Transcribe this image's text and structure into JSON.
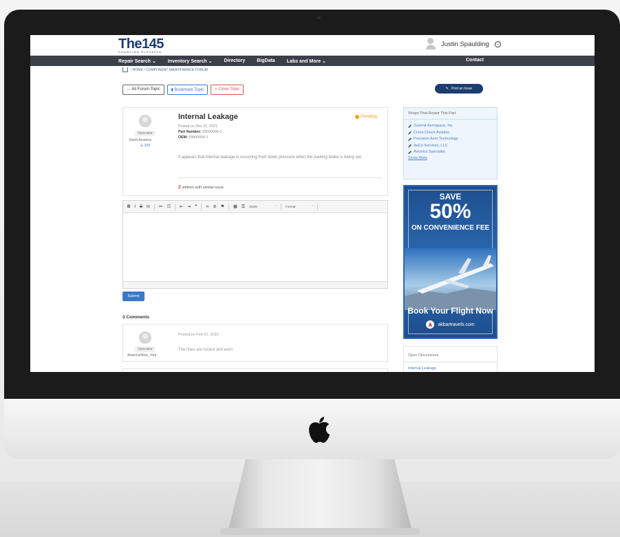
{
  "brand": {
    "logo_text": "The",
    "logo_num": "145",
    "tagline": "SOURCING ELEVATED"
  },
  "user": {
    "name": "Justin Spaulding"
  },
  "nav": {
    "items": [
      "Repair Search ⌄",
      "Inventory Search ⌄",
      "Directory",
      "BigData",
      "Labs and More ⌄"
    ],
    "contact": "Contact"
  },
  "breadcrumb": "/ HOME / COMPONENT MAINTENANCE FORUM",
  "buttons": {
    "all_forum": "← All Forum Topic",
    "bookmark": "Bookmark Topic",
    "close": "× Close Topic",
    "post_issue": "Post an Issue"
  },
  "issue": {
    "author_role": "Operator",
    "author_region": "North America",
    "author_points": "◎ 209",
    "title": "Internal Leakage",
    "status": "Pending",
    "posted": "Posted on Dec 21, 2021",
    "part_number_label": "Part Number:",
    "part_number": "59500000-1",
    "oem_label": "OEM:",
    "oem": "59500000-1",
    "body": "It appears that internal leakage is occurring from down pressure when the parking brake is being set.",
    "similar_count": "2",
    "similar_text": "airlines with similar issue"
  },
  "editor": {
    "toolbar": [
      "B",
      "I",
      "S",
      "Ix",
      "≔",
      "☷",
      "⇤",
      "⇥",
      "❞",
      "∞",
      "⊘",
      "⚑",
      "▦",
      "☰"
    ],
    "styles_label": "Styles",
    "format_label": "Format",
    "submit": "Submit"
  },
  "comments": {
    "title": "3 Comments",
    "items": [
      {
        "role": "Operator",
        "region": "America/New_York",
        "date": "Posted on Feb 01, 2022",
        "text": "The lines are rusted and worn"
      }
    ]
  },
  "shops": {
    "title": "Shops That Repair This Part",
    "items": [
      "Summit Aerospace, Inc.",
      "Cross-Check Aviation",
      "Precision Aero Technology",
      "AeCo Services, LLC",
      "Avionics Specialist"
    ],
    "show_more": "Show More"
  },
  "ad": {
    "save": "SAVE",
    "percent": "50%",
    "fee": "ON CONVENIENCE FEE",
    "cta": "Book Your Flight Now",
    "brand": "akbartravels.com"
  },
  "open_discussions": {
    "title": "Open Discussions",
    "items": [
      "Internal Leakage"
    ]
  },
  "colors": {
    "brand_navy": "#1d3c6f",
    "link_blue": "#3a78c9",
    "pending": "#f0a020",
    "danger": "#d9534f"
  }
}
